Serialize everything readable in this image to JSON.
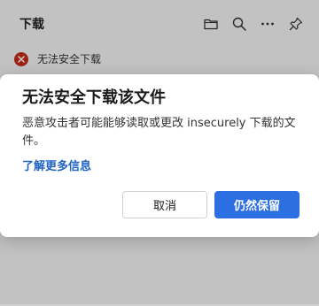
{
  "panel": {
    "title": "下载",
    "icons": [
      "folder-icon",
      "search-icon",
      "more-icon",
      "pin-icon"
    ]
  },
  "download_item": {
    "status_icon": "error-icon",
    "status_color": "#c42b1c",
    "label": "无法安全下载"
  },
  "dialog": {
    "title": "无法安全下载该文件",
    "body": "恶意攻击者可能能够读取或更改 insecurely 下载的文件。",
    "learn_more": "了解更多信息",
    "cancel_label": "取消",
    "keep_label": "仍然保留",
    "accent": "#2b6fe2"
  }
}
